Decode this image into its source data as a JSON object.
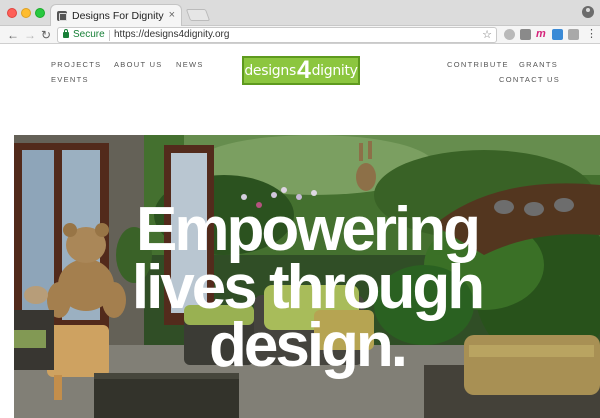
{
  "browser": {
    "tab_title": "Designs For Dignity",
    "tab_close": "×",
    "secure_label": "Secure",
    "url": "https://designs4dignity.org",
    "icons": [
      "back-arrow-icon",
      "forward-arrow-icon",
      "reload-icon",
      "lock-icon",
      "star-icon",
      "menu-icon",
      "profile-icon"
    ]
  },
  "nav": {
    "left": [
      "PROJECTS",
      "ABOUT US",
      "NEWS",
      "EVENTS"
    ],
    "right": [
      "CONTRIBUTE",
      "GRANTS",
      "CONTACT US"
    ]
  },
  "logo": {
    "left_word": "designs",
    "number": "4",
    "right_word": "dignity",
    "color": "#8cc63f"
  },
  "hero": {
    "headline_lines": [
      "Empowering",
      "lives through",
      "design."
    ]
  }
}
